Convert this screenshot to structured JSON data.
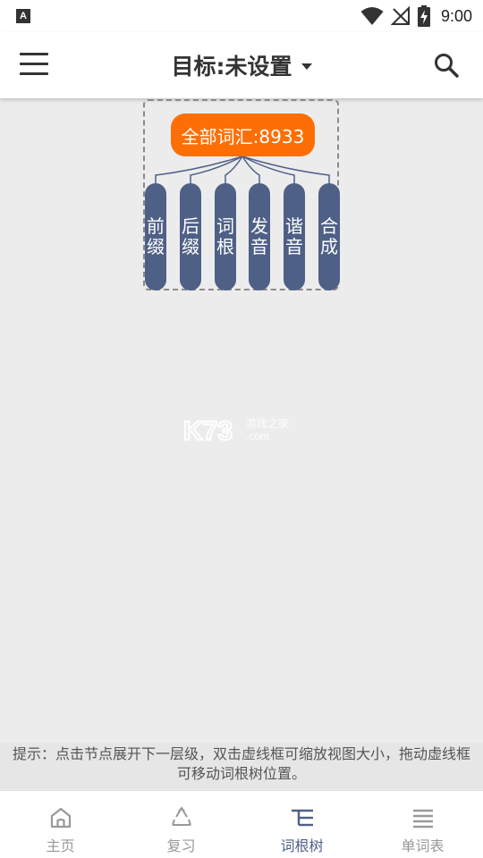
{
  "status_bar": {
    "app_icon_letter": "A",
    "time": "9:00"
  },
  "header": {
    "title": "目标:未设置"
  },
  "tree": {
    "root_label": "全部词汇:8933",
    "children": [
      {
        "line1": "前",
        "line2": "缀"
      },
      {
        "line1": "后",
        "line2": "缀"
      },
      {
        "line1": "词",
        "line2": "根"
      },
      {
        "line1": "发",
        "line2": "音"
      },
      {
        "line1": "谐",
        "line2": "音"
      },
      {
        "line1": "合",
        "line2": "成"
      }
    ]
  },
  "watermark": {
    "brand": "K73",
    "subtitle": "游戏之家",
    "domain": ".com"
  },
  "hint": {
    "text": "提示：点击节点展开下一层级，双击虚线框可缩放视图大小，拖动虚线框可移动词根树位置。"
  },
  "bottom_nav": {
    "items": [
      {
        "label": "主页",
        "icon": "home-icon"
      },
      {
        "label": "复习",
        "icon": "recycle-icon"
      },
      {
        "label": "词根树",
        "icon": "tree-icon"
      },
      {
        "label": "单词表",
        "icon": "list-icon"
      }
    ],
    "active_index": 2
  },
  "colors": {
    "root_node": "#fd6f05",
    "child_node": "#4f6087",
    "active_nav": "#4f6087",
    "inactive_nav": "#999999"
  }
}
